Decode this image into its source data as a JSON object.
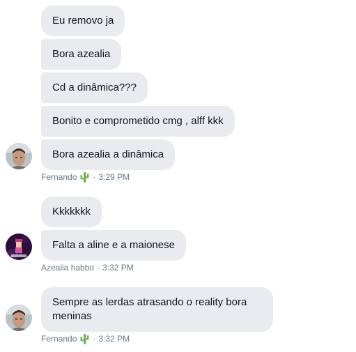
{
  "conversation": {
    "group1": {
      "messages": [
        "Eu removo ja",
        "Bora azealia",
        "Cd a dinâmica???",
        "Bonito e comprometido cmg , alff kkk",
        "Bora azealia a dinâmica"
      ],
      "sender": "Fernando",
      "sender_emoji": "cactus-icon",
      "separator": "·",
      "time": "3:29 PM"
    },
    "group2": {
      "messages": [
        "Kkkkkkk",
        "Falta a aline e a maionese"
      ],
      "sender": "Azealia habbo",
      "separator": "·",
      "time": "3:32 PM"
    },
    "group3": {
      "messages": [
        "Sempre as lerdas atrasando o reality bora meninas"
      ],
      "sender": "Fernando",
      "sender_emoji": "cactus-icon",
      "separator": "·",
      "time": "3:32 PM"
    }
  },
  "colors": {
    "bubble_bg": "#e9ebee",
    "bubble_text": "#14171a",
    "meta_text": "#657786",
    "cactus": "#77b255"
  }
}
